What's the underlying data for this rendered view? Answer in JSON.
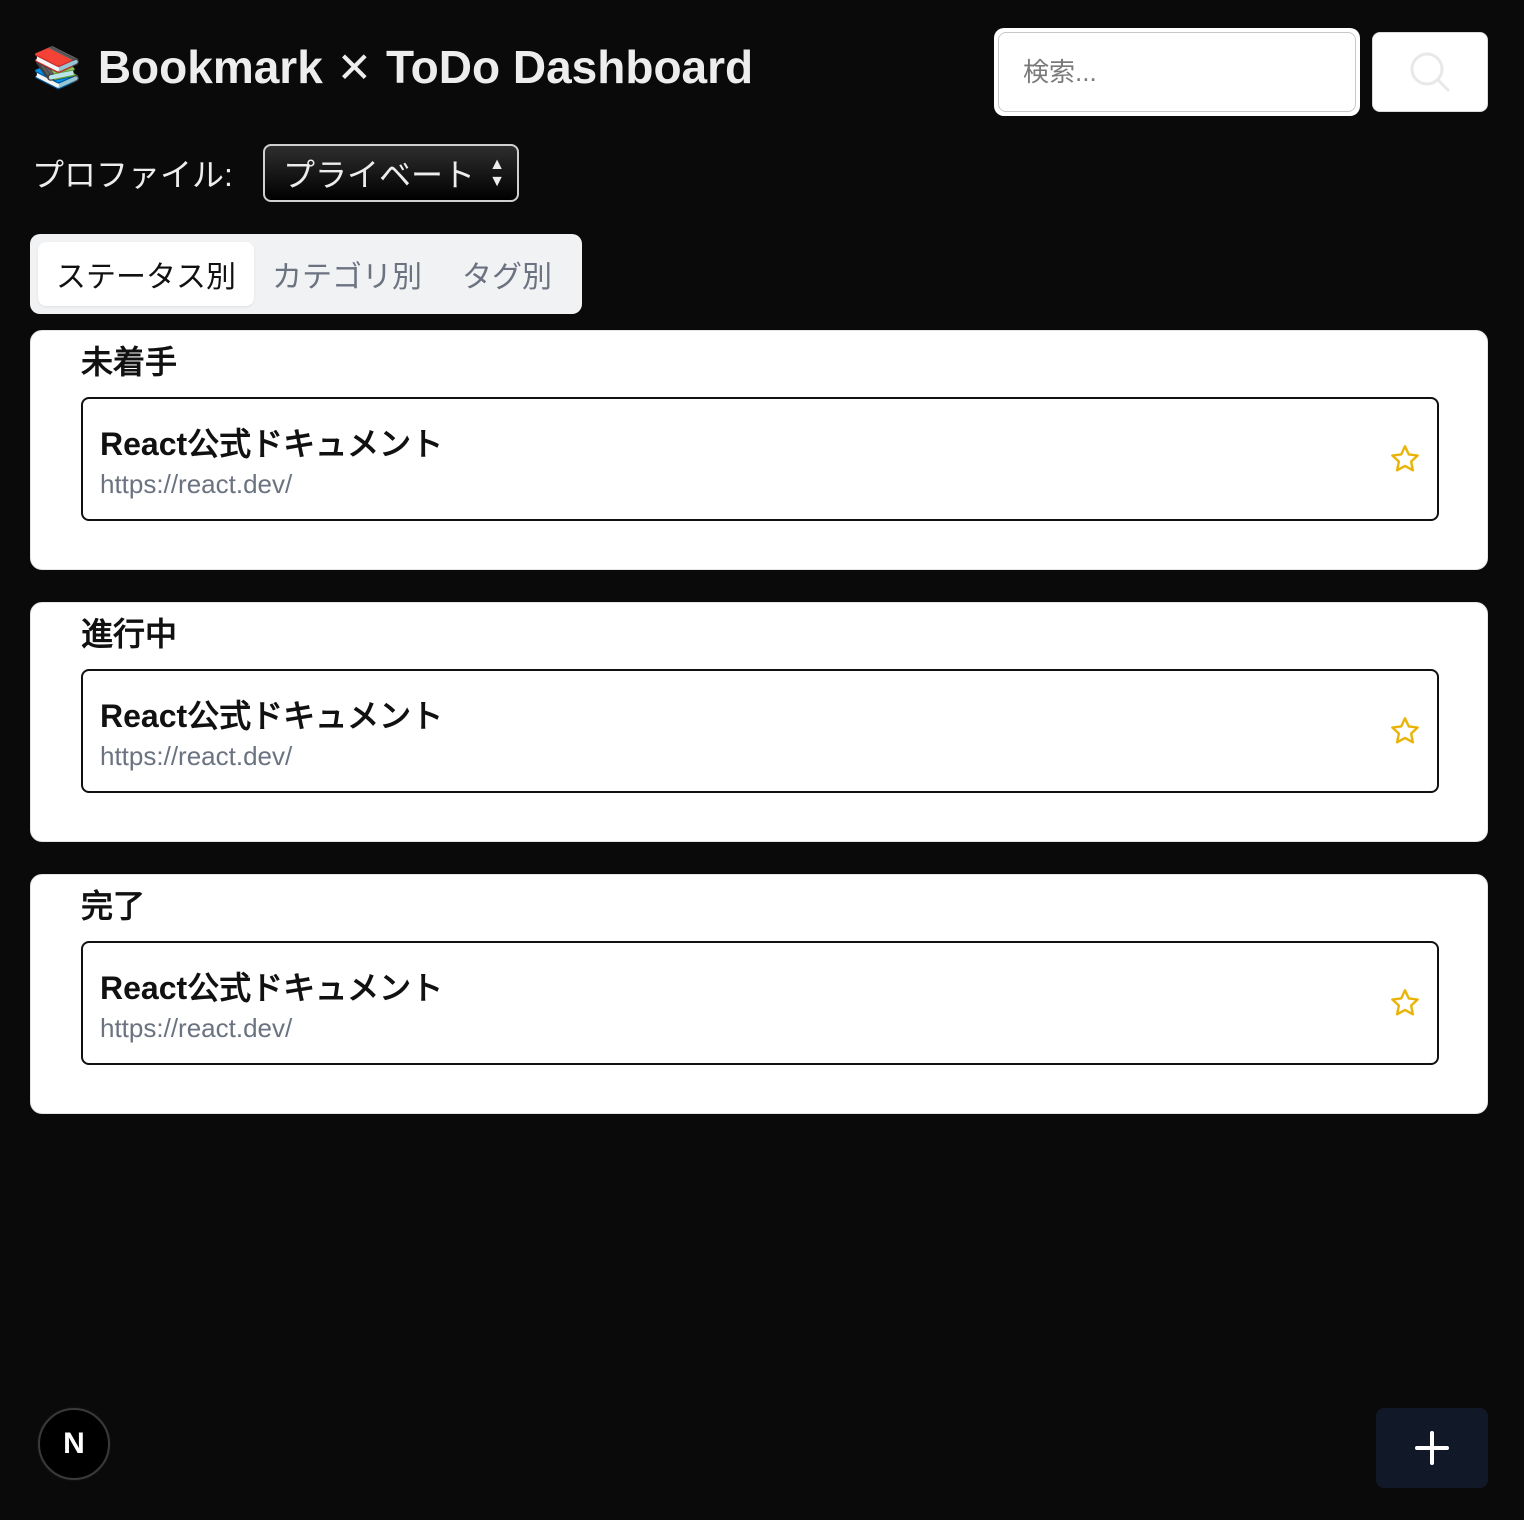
{
  "header": {
    "icon": "books-emoji-icon",
    "icon_glyph": "📚",
    "title_left": "Bookmark",
    "title_sep": "✕",
    "title_right": "ToDo Dashboard"
  },
  "search": {
    "placeholder": "検索...",
    "value": "",
    "button_icon": "search-icon"
  },
  "profile": {
    "label": "プロファイル:",
    "selected": "プライベート"
  },
  "tabs": [
    {
      "label": "ステータス別",
      "active": true
    },
    {
      "label": "カテゴリ別",
      "active": false
    },
    {
      "label": "タグ別",
      "active": false
    }
  ],
  "sections": [
    {
      "title": "未着手",
      "items": [
        {
          "title": "React公式ドキュメント",
          "url": "https://react.dev/",
          "favorite": false
        }
      ]
    },
    {
      "title": "進行中",
      "items": [
        {
          "title": "React公式ドキュメント",
          "url": "https://react.dev/",
          "favorite": false
        }
      ]
    },
    {
      "title": "完了",
      "items": [
        {
          "title": "React公式ドキュメント",
          "url": "https://react.dev/",
          "favorite": false
        }
      ]
    }
  ],
  "footer": {
    "badge_letter": "N",
    "add_icon": "plus-icon"
  },
  "colors": {
    "background": "#0a0a0a",
    "star": "#eab308",
    "add_button": "#111827"
  }
}
